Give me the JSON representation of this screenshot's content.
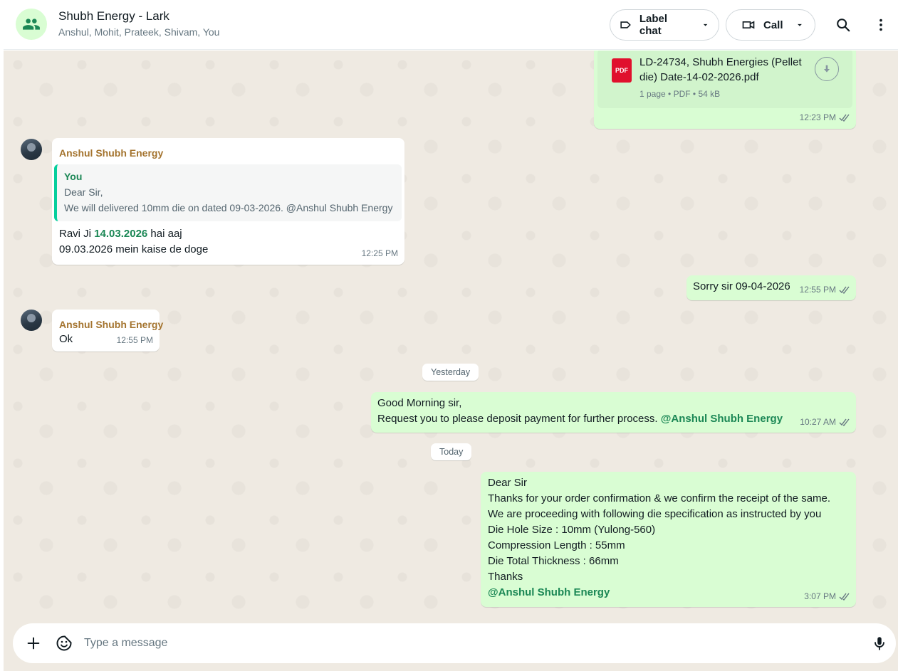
{
  "header": {
    "title": "Shubh Energy - Lark",
    "members": "Anshul, Mohit, Prateek, Shivam, You",
    "label_chat": "Label chat",
    "call": "Call"
  },
  "colors": {
    "outgoing_bubble": "#d9fdd3",
    "incoming_bubble": "#ffffff",
    "chat_background": "#efeae2",
    "sender_name": "#a4742f",
    "mention": "#1b8755",
    "read_ticks": "#53bdeb"
  },
  "messages": {
    "pdf": {
      "file_name_line1": "LD-24734, Shubh Energies (Pellet",
      "file_name_line2": "die) Date-14-02-2026.pdf",
      "meta": "1 page • PDF • 54 kB",
      "badge": "PDF",
      "time": "12:23 PM"
    },
    "reply": {
      "sender": "Anshul Shubh Energy",
      "quoted_sender": "You",
      "quoted_line1": "Dear Sir,",
      "quoted_line2": "We will delivered 10mm die on dated 09-03-2026. @Anshul Shubh Energy",
      "text_prefix": "Ravi Ji ",
      "text_date": "14.03.2026",
      "text_suffix": " hai aaj",
      "text_line2": "09.03.2026 mein kaise de doge",
      "time": "12:25 PM"
    },
    "sorry": {
      "text": "Sorry sir 09-04-2026",
      "time": "12:55 PM"
    },
    "ok": {
      "sender": "Anshul Shubh Energy",
      "text": "Ok",
      "time": "12:55 PM"
    },
    "yesterday_chip": "Yesterday",
    "good_morning": {
      "line1": "Good Morning sir,",
      "line2": "Request you to please deposit payment for further process. ",
      "mention": "@Anshul Shubh Energy",
      "time": "10:27 AM"
    },
    "today_chip": "Today",
    "dear_sir": {
      "lines": [
        "Dear Sir",
        "Thanks for your order confirmation & we confirm the receipt of the same.",
        "We are proceeding with following die specification as instructed by you",
        "Die Hole Size : 10mm (Yulong-560)",
        "Compression Length : 55mm",
        "Die Total Thickness : 66mm",
        "Thanks"
      ],
      "mention": "@Anshul Shubh Energy",
      "time": "3:07 PM"
    }
  },
  "composer": {
    "placeholder": "Type a message"
  }
}
